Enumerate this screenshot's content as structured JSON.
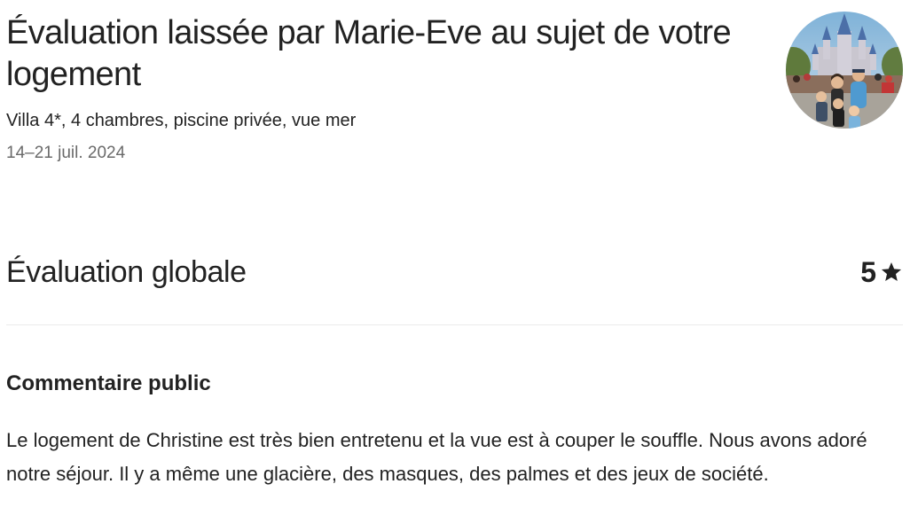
{
  "review": {
    "title": "Évaluation laissée par Marie-Eve au sujet de votre logement",
    "listing_name": "Villa 4*, 4 chambres, piscine privée, vue mer",
    "dates": "14–21 juil. 2024"
  },
  "overall": {
    "label": "Évaluation globale",
    "rating": "5",
    "icon": "star-icon"
  },
  "comment": {
    "heading": "Commentaire public",
    "text": "Le logement de Christine est très bien entretenu et la vue est à couper le souffle. Nous avons adoré notre séjour. Il y a même une glacière, des masques, des palmes et des jeux de société."
  },
  "colors": {
    "text": "#222222",
    "secondary_text": "#6a6a6a",
    "divider": "#ebebeb"
  }
}
